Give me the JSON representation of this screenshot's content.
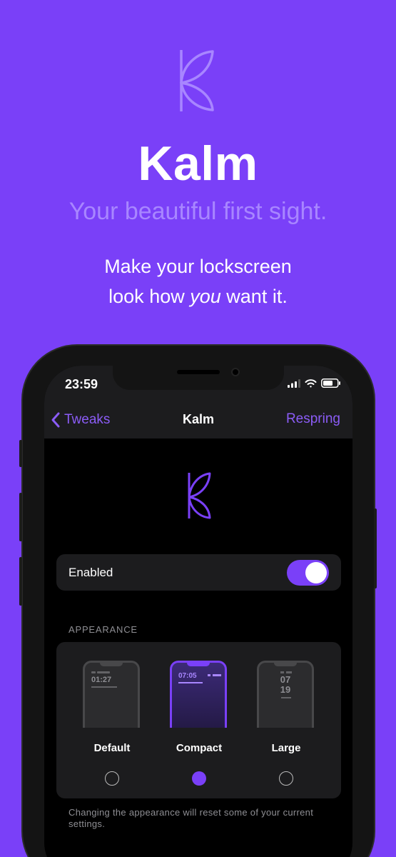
{
  "hero": {
    "title": "Kalm",
    "subtitle": "Your beautiful first sight.",
    "tagline_line1": "Make your lockscreen",
    "tagline_pre": "look how ",
    "tagline_em": "you",
    "tagline_post": " want it."
  },
  "status_bar": {
    "time": "23:59"
  },
  "nav": {
    "back_label": "Tweaks",
    "title": "Kalm",
    "action_label": "Respring"
  },
  "settings": {
    "enabled_label": "Enabled",
    "enabled": true,
    "appearance_header": "APPEARANCE",
    "options": [
      {
        "label": "Default",
        "preview_time": "01:27"
      },
      {
        "label": "Compact",
        "preview_time": "07:05"
      },
      {
        "label": "Large",
        "preview_hour": "07",
        "preview_minute": "19"
      }
    ],
    "selected_option": "Compact",
    "footnote": "Changing the appearance will reset some of your current settings."
  },
  "colors": {
    "accent": "#7a40f8",
    "background": "#7a40f8",
    "subtitle": "#a886ff",
    "card": "#1c1c1e"
  },
  "icons": [
    "kalm-logo-icon",
    "chevron-left-icon",
    "signal-icon",
    "wifi-icon",
    "battery-icon"
  ]
}
